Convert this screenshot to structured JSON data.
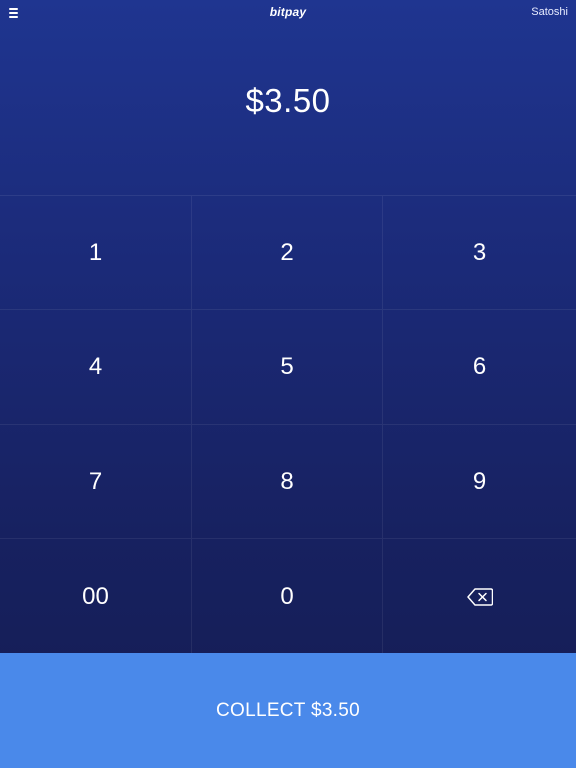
{
  "header": {
    "logo_text": "bitpay",
    "unit_label": "Satoshi",
    "menu_icon": "hamburger-icon"
  },
  "amount": {
    "display": "$3.50"
  },
  "keypad": {
    "keys": [
      "1",
      "2",
      "3",
      "4",
      "5",
      "6",
      "7",
      "8",
      "9",
      "00",
      "0"
    ],
    "backspace_icon": "backspace-icon"
  },
  "collect": {
    "label": "COLLECT $3.50"
  },
  "colors": {
    "background_top": "#1f3590",
    "background_bottom": "#141c52",
    "collect_button": "#4a89ea",
    "text": "#ffffff"
  }
}
